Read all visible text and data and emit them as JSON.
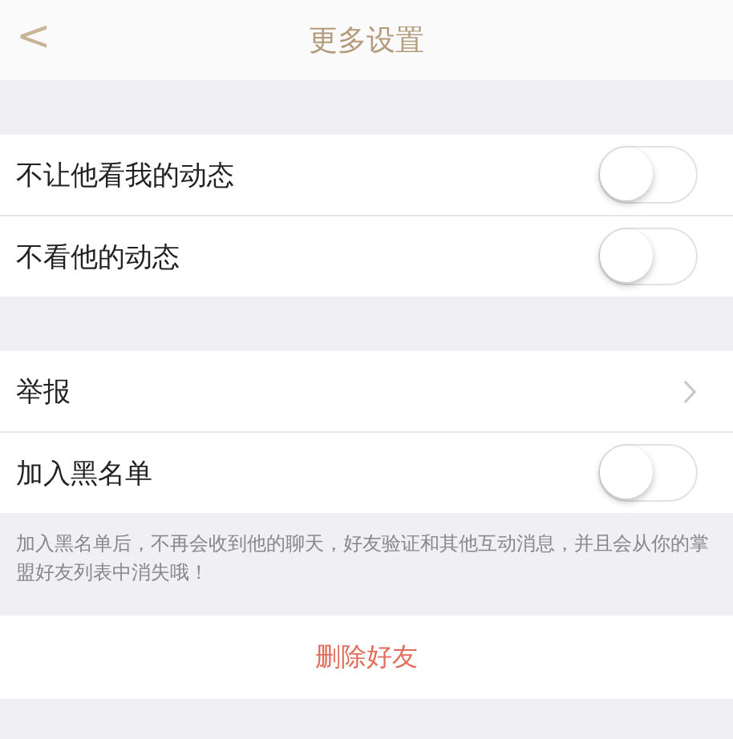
{
  "header": {
    "back": "<",
    "title": "更多设置"
  },
  "groups": [
    {
      "rows": [
        {
          "kind": "toggle",
          "label": "不让他看我的动态",
          "on": false
        },
        {
          "kind": "toggle",
          "label": "不看他的动态",
          "on": false
        }
      ]
    },
    {
      "rows": [
        {
          "kind": "link",
          "label": "举报"
        },
        {
          "kind": "toggle",
          "label": "加入黑名单",
          "on": false
        }
      ],
      "note": "加入黑名单后，不再会收到他的聊天，好友验证和其他互动消息，并且会从你的掌盟好友列表中消失哦！"
    }
  ],
  "delete_button": "删除好友"
}
